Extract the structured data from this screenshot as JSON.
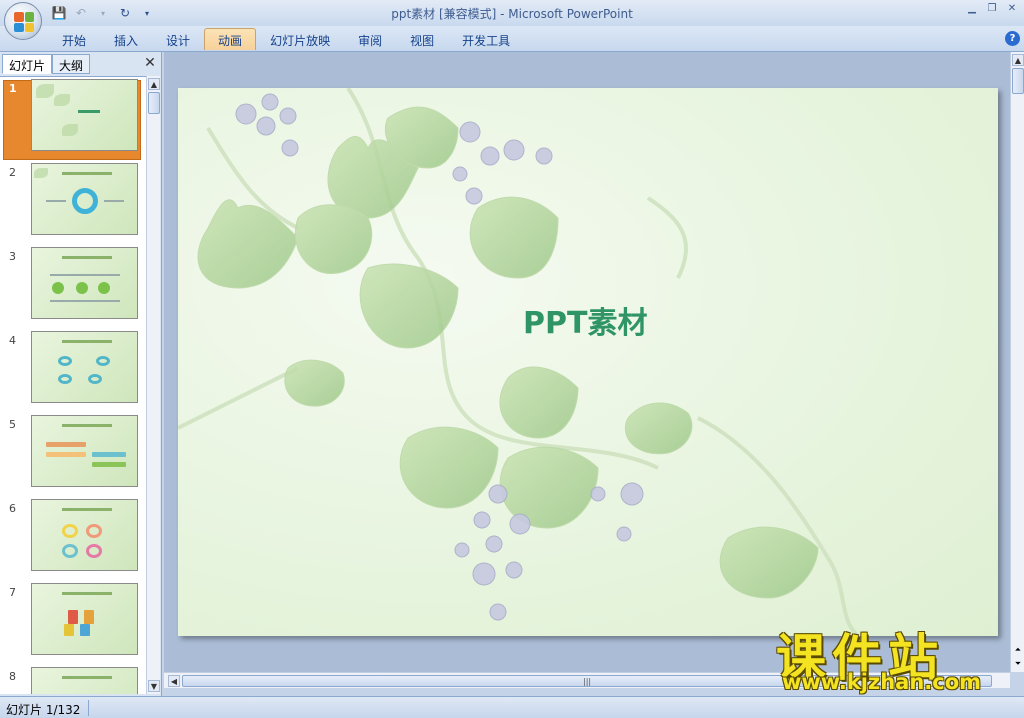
{
  "window": {
    "title": "ppt素材 [兼容模式] - Microsoft PowerPoint",
    "controls": [
      "▁",
      "❐",
      "✕"
    ]
  },
  "quick_access": {
    "save_icon": "save-icon",
    "undo_icon": "undo-icon",
    "redo_icon": "redo-icon"
  },
  "ribbon": {
    "tabs": [
      {
        "label": "开始"
      },
      {
        "label": "插入"
      },
      {
        "label": "设计"
      },
      {
        "label": "动画"
      },
      {
        "label": "幻灯片放映"
      },
      {
        "label": "审阅"
      },
      {
        "label": "视图"
      },
      {
        "label": "开发工具"
      }
    ],
    "active_tab": "动画",
    "help_label": "?"
  },
  "left_pane": {
    "tabs": [
      {
        "label": "幻灯片"
      },
      {
        "label": "大纲"
      }
    ],
    "close_label": "✕",
    "thumbnails": [
      {
        "number": "1",
        "selected": true
      },
      {
        "number": "2",
        "selected": false
      },
      {
        "number": "3",
        "selected": false
      },
      {
        "number": "4",
        "selected": false
      },
      {
        "number": "5",
        "selected": false
      },
      {
        "number": "6",
        "selected": false
      },
      {
        "number": "7",
        "selected": false
      },
      {
        "number": "8",
        "selected": false
      }
    ]
  },
  "slide": {
    "title": "PPT素材"
  },
  "status": {
    "slide_position": "幻灯片 1/132"
  },
  "watermark": {
    "text": "课件站",
    "url": "www.kjzhan.com"
  },
  "colors": {
    "title_green": "#2f9466",
    "active_tab": "#f7d19a",
    "selected_thumb": "#e8882e",
    "watermark_yellow": "#f3e320"
  }
}
